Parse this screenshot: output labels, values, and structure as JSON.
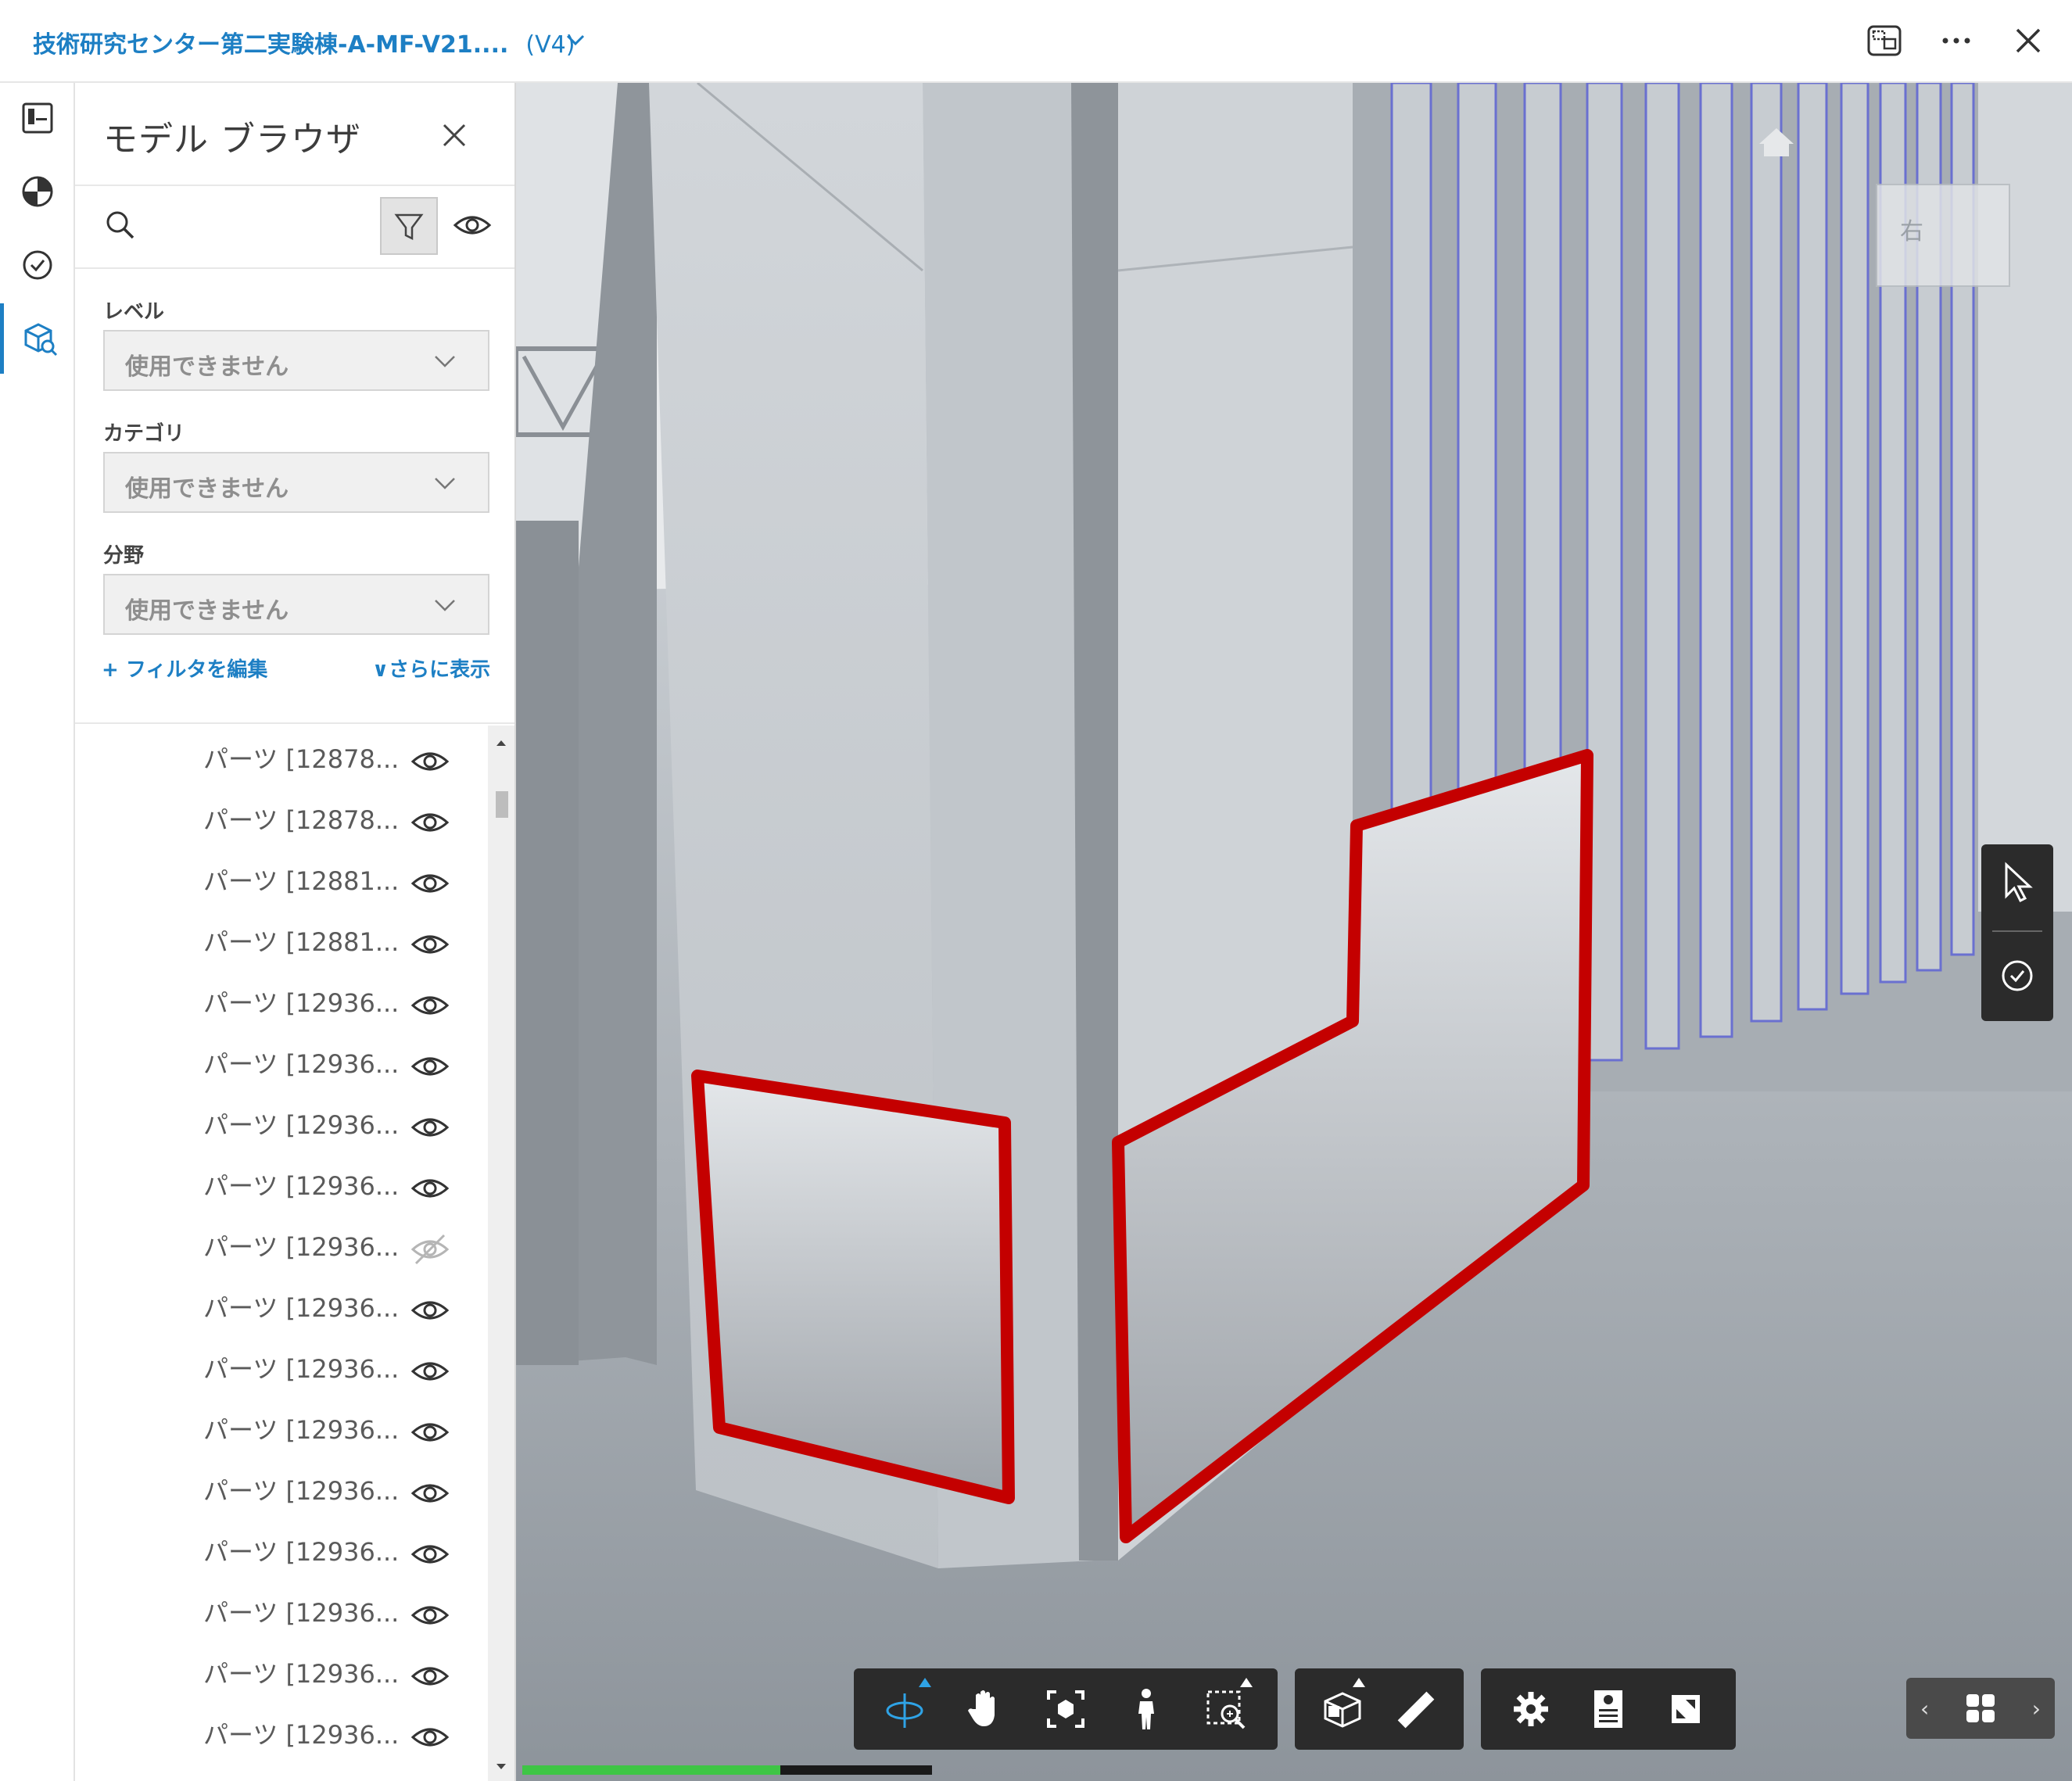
{
  "header": {
    "title": "技術研究センター第二実験棟-A-MF-V21....",
    "version": "(V4)"
  },
  "panel": {
    "title": "モデル ブラウザ",
    "filters": [
      {
        "label": "レベル",
        "value": "使用できません"
      },
      {
        "label": "カテゴリ",
        "value": "使用できません"
      },
      {
        "label": "分野",
        "value": "使用できません"
      }
    ],
    "edit_filter_link": "+ フィルタを編集",
    "show_more_link": "∨さらに表示",
    "items": [
      {
        "label": "パーツ [12878...",
        "visible": true
      },
      {
        "label": "パーツ [12878...",
        "visible": true
      },
      {
        "label": "パーツ [12881...",
        "visible": true
      },
      {
        "label": "パーツ [12881...",
        "visible": true
      },
      {
        "label": "パーツ [12936...",
        "visible": true
      },
      {
        "label": "パーツ [12936...",
        "visible": true
      },
      {
        "label": "パーツ [12936...",
        "visible": true
      },
      {
        "label": "パーツ [12936...",
        "visible": true
      },
      {
        "label": "パーツ [12936...",
        "visible": false
      },
      {
        "label": "パーツ [12936...",
        "visible": true
      },
      {
        "label": "パーツ [12936...",
        "visible": true
      },
      {
        "label": "パーツ [12936...",
        "visible": true
      },
      {
        "label": "パーツ [12936...",
        "visible": true
      },
      {
        "label": "パーツ [12936...",
        "visible": true
      },
      {
        "label": "パーツ [12936...",
        "visible": true
      },
      {
        "label": "パーツ [12936...",
        "visible": true
      },
      {
        "label": "パーツ [12936...",
        "visible": true
      }
    ]
  },
  "viewcube": {
    "face_label": "右"
  },
  "loading_progress": 0.63,
  "colors": {
    "accent": "#1d7fc4",
    "markup": "#c40000",
    "progress": "#3ec545",
    "toolbar": "#2b2b2b"
  }
}
